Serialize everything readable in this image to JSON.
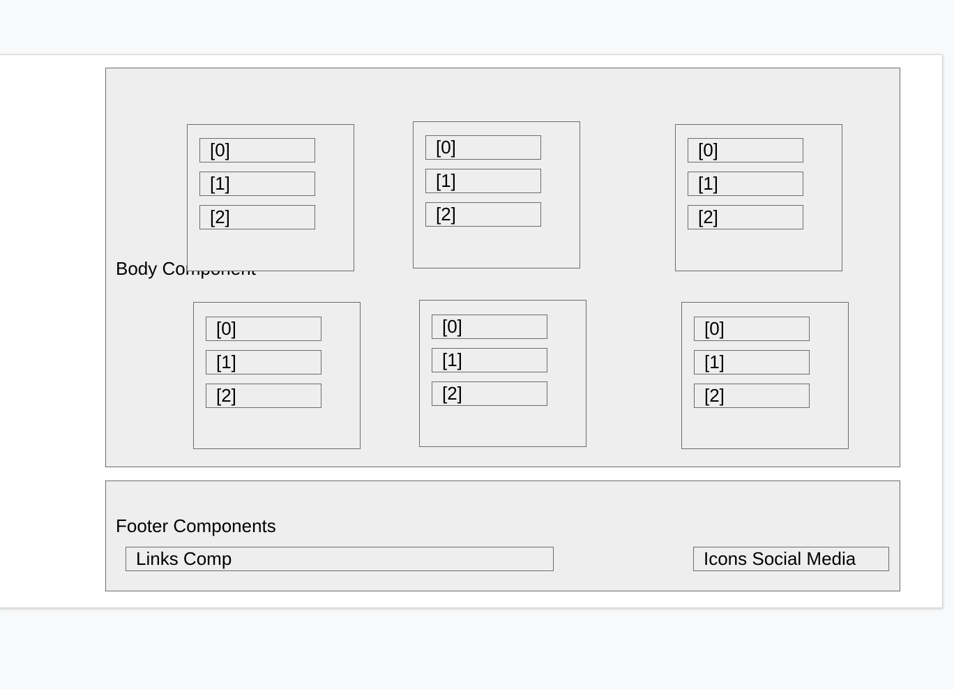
{
  "body": {
    "label": "Body Component",
    "cards": [
      {
        "items": [
          "[0]",
          "[1]",
          "[2]"
        ]
      },
      {
        "items": [
          "[0]",
          "[1]",
          "[2]"
        ]
      },
      {
        "items": [
          "[0]",
          "[1]",
          "[2]"
        ]
      },
      {
        "items": [
          "[0]",
          "[1]",
          "[2]"
        ]
      },
      {
        "items": [
          "[0]",
          "[1]",
          "[2]"
        ]
      },
      {
        "items": [
          "[0]",
          "[1]",
          "[2]"
        ]
      }
    ]
  },
  "footer": {
    "label": "Footer Components",
    "links": "Links Comp",
    "social": "Icons Social Media"
  }
}
